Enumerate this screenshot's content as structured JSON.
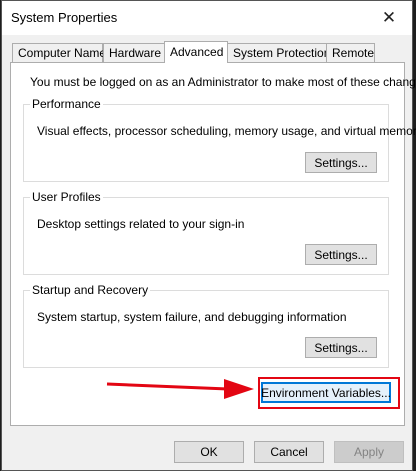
{
  "window": {
    "title": "System Properties",
    "close_glyph": "✕"
  },
  "tabs": [
    {
      "label": "Computer Name"
    },
    {
      "label": "Hardware"
    },
    {
      "label": "Advanced",
      "active": true
    },
    {
      "label": "System Protection"
    },
    {
      "label": "Remote"
    }
  ],
  "panel": {
    "notice": "You must be logged on as an Administrator to make most of these changes.",
    "groups": {
      "performance": {
        "title": "Performance",
        "description": "Visual effects, processor scheduling, memory usage, and virtual memory",
        "button": "Settings..."
      },
      "user_profiles": {
        "title": "User Profiles",
        "description": "Desktop settings related to your sign-in",
        "button": "Settings..."
      },
      "startup_recovery": {
        "title": "Startup and Recovery",
        "description": "System startup, system failure, and debugging information",
        "button": "Settings..."
      }
    },
    "env_button": "Environment Variables..."
  },
  "footer": {
    "ok": "OK",
    "cancel": "Cancel",
    "apply": "Apply"
  },
  "annotation": {
    "highlight_color": "#e30613",
    "arrow_color": "#e30613"
  }
}
